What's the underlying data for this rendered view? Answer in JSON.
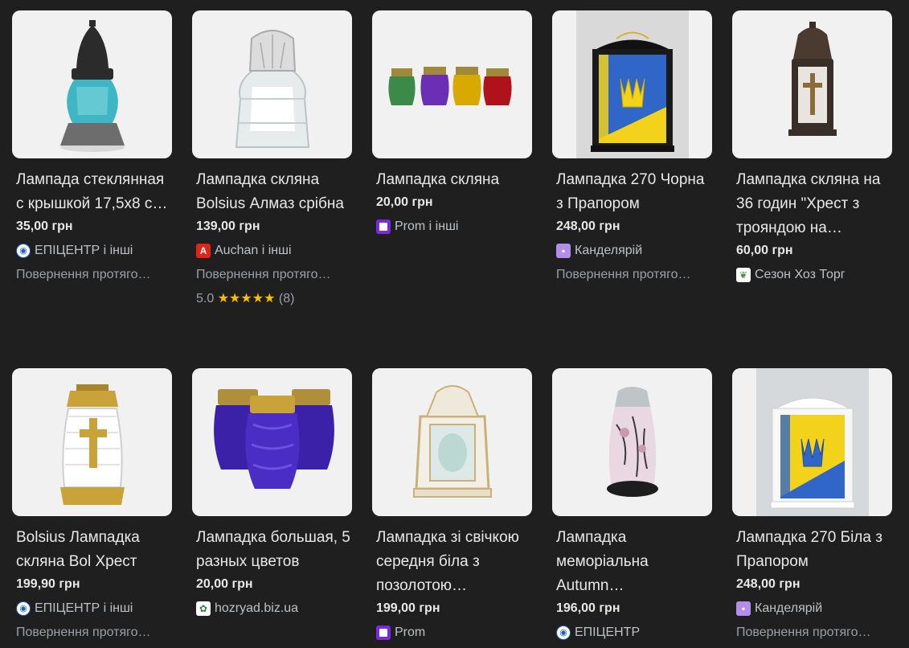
{
  "products": [
    {
      "title": "Лампада стеклянная с крышкой 17,5x8 с…",
      "price": "35,00 грн",
      "seller": "ЕПІЦЕНТР і інші",
      "seller_icon": "epicentr-icon",
      "returns": "Повернення протяго…",
      "image": "teal-grave-lamp-image"
    },
    {
      "title": "Лампадка скляна Bolsius Алмаз срібна",
      "price": "139,00 грн",
      "seller": "Auchan і інші",
      "seller_icon": "auchan-icon",
      "returns": "Повернення протяго…",
      "rating": "5.0",
      "stars": "★★★★★",
      "reviews": "(8)",
      "image": "clear-diamond-lamp-image"
    },
    {
      "title": "Лампадка скляна",
      "price": "20,00 грн",
      "seller": "Prom і інші",
      "seller_icon": "prom-icon",
      "image": "four-colored-lamps-image"
    },
    {
      "title": "Лампадка 270 Чорна з Прапором",
      "price": "248,00 грн",
      "seller": "Канделярій",
      "seller_icon": "kandelyarii-icon",
      "returns": "Повернення протяго…",
      "image": "black-flag-lamp-image"
    },
    {
      "title": "Лампадка скляна на 36 годин \"Хрест з трояндою на…",
      "price": "60,00 грн",
      "seller": "Сезон Хоз Торг",
      "seller_icon": "sezon-icon",
      "image": "bronze-cross-lamp-image"
    },
    {
      "title": "Bolsius Лампадка скляна Bol Хрест",
      "price": "199,90 грн",
      "seller": "ЕПІЦЕНТР і інші",
      "seller_icon": "epicentr-icon",
      "returns": "Повернення протяго…",
      "image": "gold-cross-lamp-image"
    },
    {
      "title": "Лампадка большая, 5 разных цветов",
      "price": "20,00 грн",
      "seller": "hozryad.biz.ua",
      "seller_icon": "hozryad-icon",
      "image": "blue-lamps-image"
    },
    {
      "title": "Лампадка зі свічкою середня біла з позолотою…",
      "price": "199,00 грн",
      "seller": "Prom",
      "seller_icon": "prom-icon",
      "image": "white-gold-lantern-image"
    },
    {
      "title": "Лампадка меморіальна Autumn…",
      "price": "196,00 грн",
      "seller": "ЕПІЦЕНТР",
      "seller_icon": "epicentr-icon",
      "image": "autumn-memorial-lamp-image"
    },
    {
      "title": "Лампадка 270 Біла з Прапором",
      "price": "248,00 грн",
      "seller": "Канделярій",
      "seller_icon": "kandelyarii-icon",
      "returns": "Повернення протяго…",
      "image": "white-flag-lamp-image"
    }
  ],
  "colors": {
    "background": "#1f1f1f",
    "thumb_bg": "#f1f1f1",
    "star": "#fbbc04"
  }
}
